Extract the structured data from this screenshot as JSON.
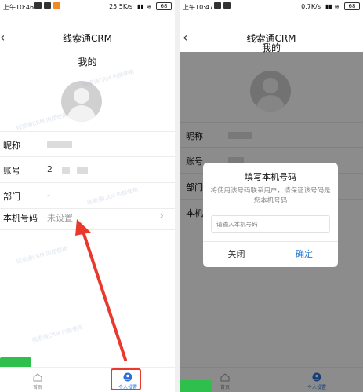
{
  "left": {
    "status": {
      "time": "上午10:46",
      "network": "25.5K/s",
      "battery": "68"
    },
    "nav": {
      "back": "‹",
      "title": "线索通CRM"
    },
    "subtitle": "我的",
    "rows": [
      {
        "label": "昵称",
        "value": ""
      },
      {
        "label": "账号",
        "value": "2"
      },
      {
        "label": "部门",
        "value": "-"
      },
      {
        "label": "本机号码",
        "value": "未设置",
        "chevron": "›"
      }
    ],
    "tabs": [
      {
        "label": "首页"
      },
      {
        "label": "个人设置"
      }
    ],
    "watermark": "线索通CRM 内部使用"
  },
  "right": {
    "status": {
      "time": "上午10:47",
      "network": "0.7K/s",
      "battery": "68"
    },
    "nav": {
      "back": "‹",
      "title": "线索通CRM"
    },
    "subtitle": "我的",
    "rows": [
      {
        "label": "昵称"
      },
      {
        "label": "账号"
      },
      {
        "label": "部门"
      },
      {
        "label": "本机"
      }
    ],
    "tabs": [
      {
        "label": "首页"
      },
      {
        "label": "个人设置"
      }
    ],
    "dialog": {
      "title": "填写本机号码",
      "description": "将使用该号码联系用户，请保证该号码是您本机号码",
      "input_placeholder": "请输入本机号码",
      "cancel": "关闭",
      "confirm": "确定"
    }
  },
  "colors": {
    "accent": "#2a7ad6",
    "arrow": "#e8392c",
    "highlight": "#e8392c"
  }
}
